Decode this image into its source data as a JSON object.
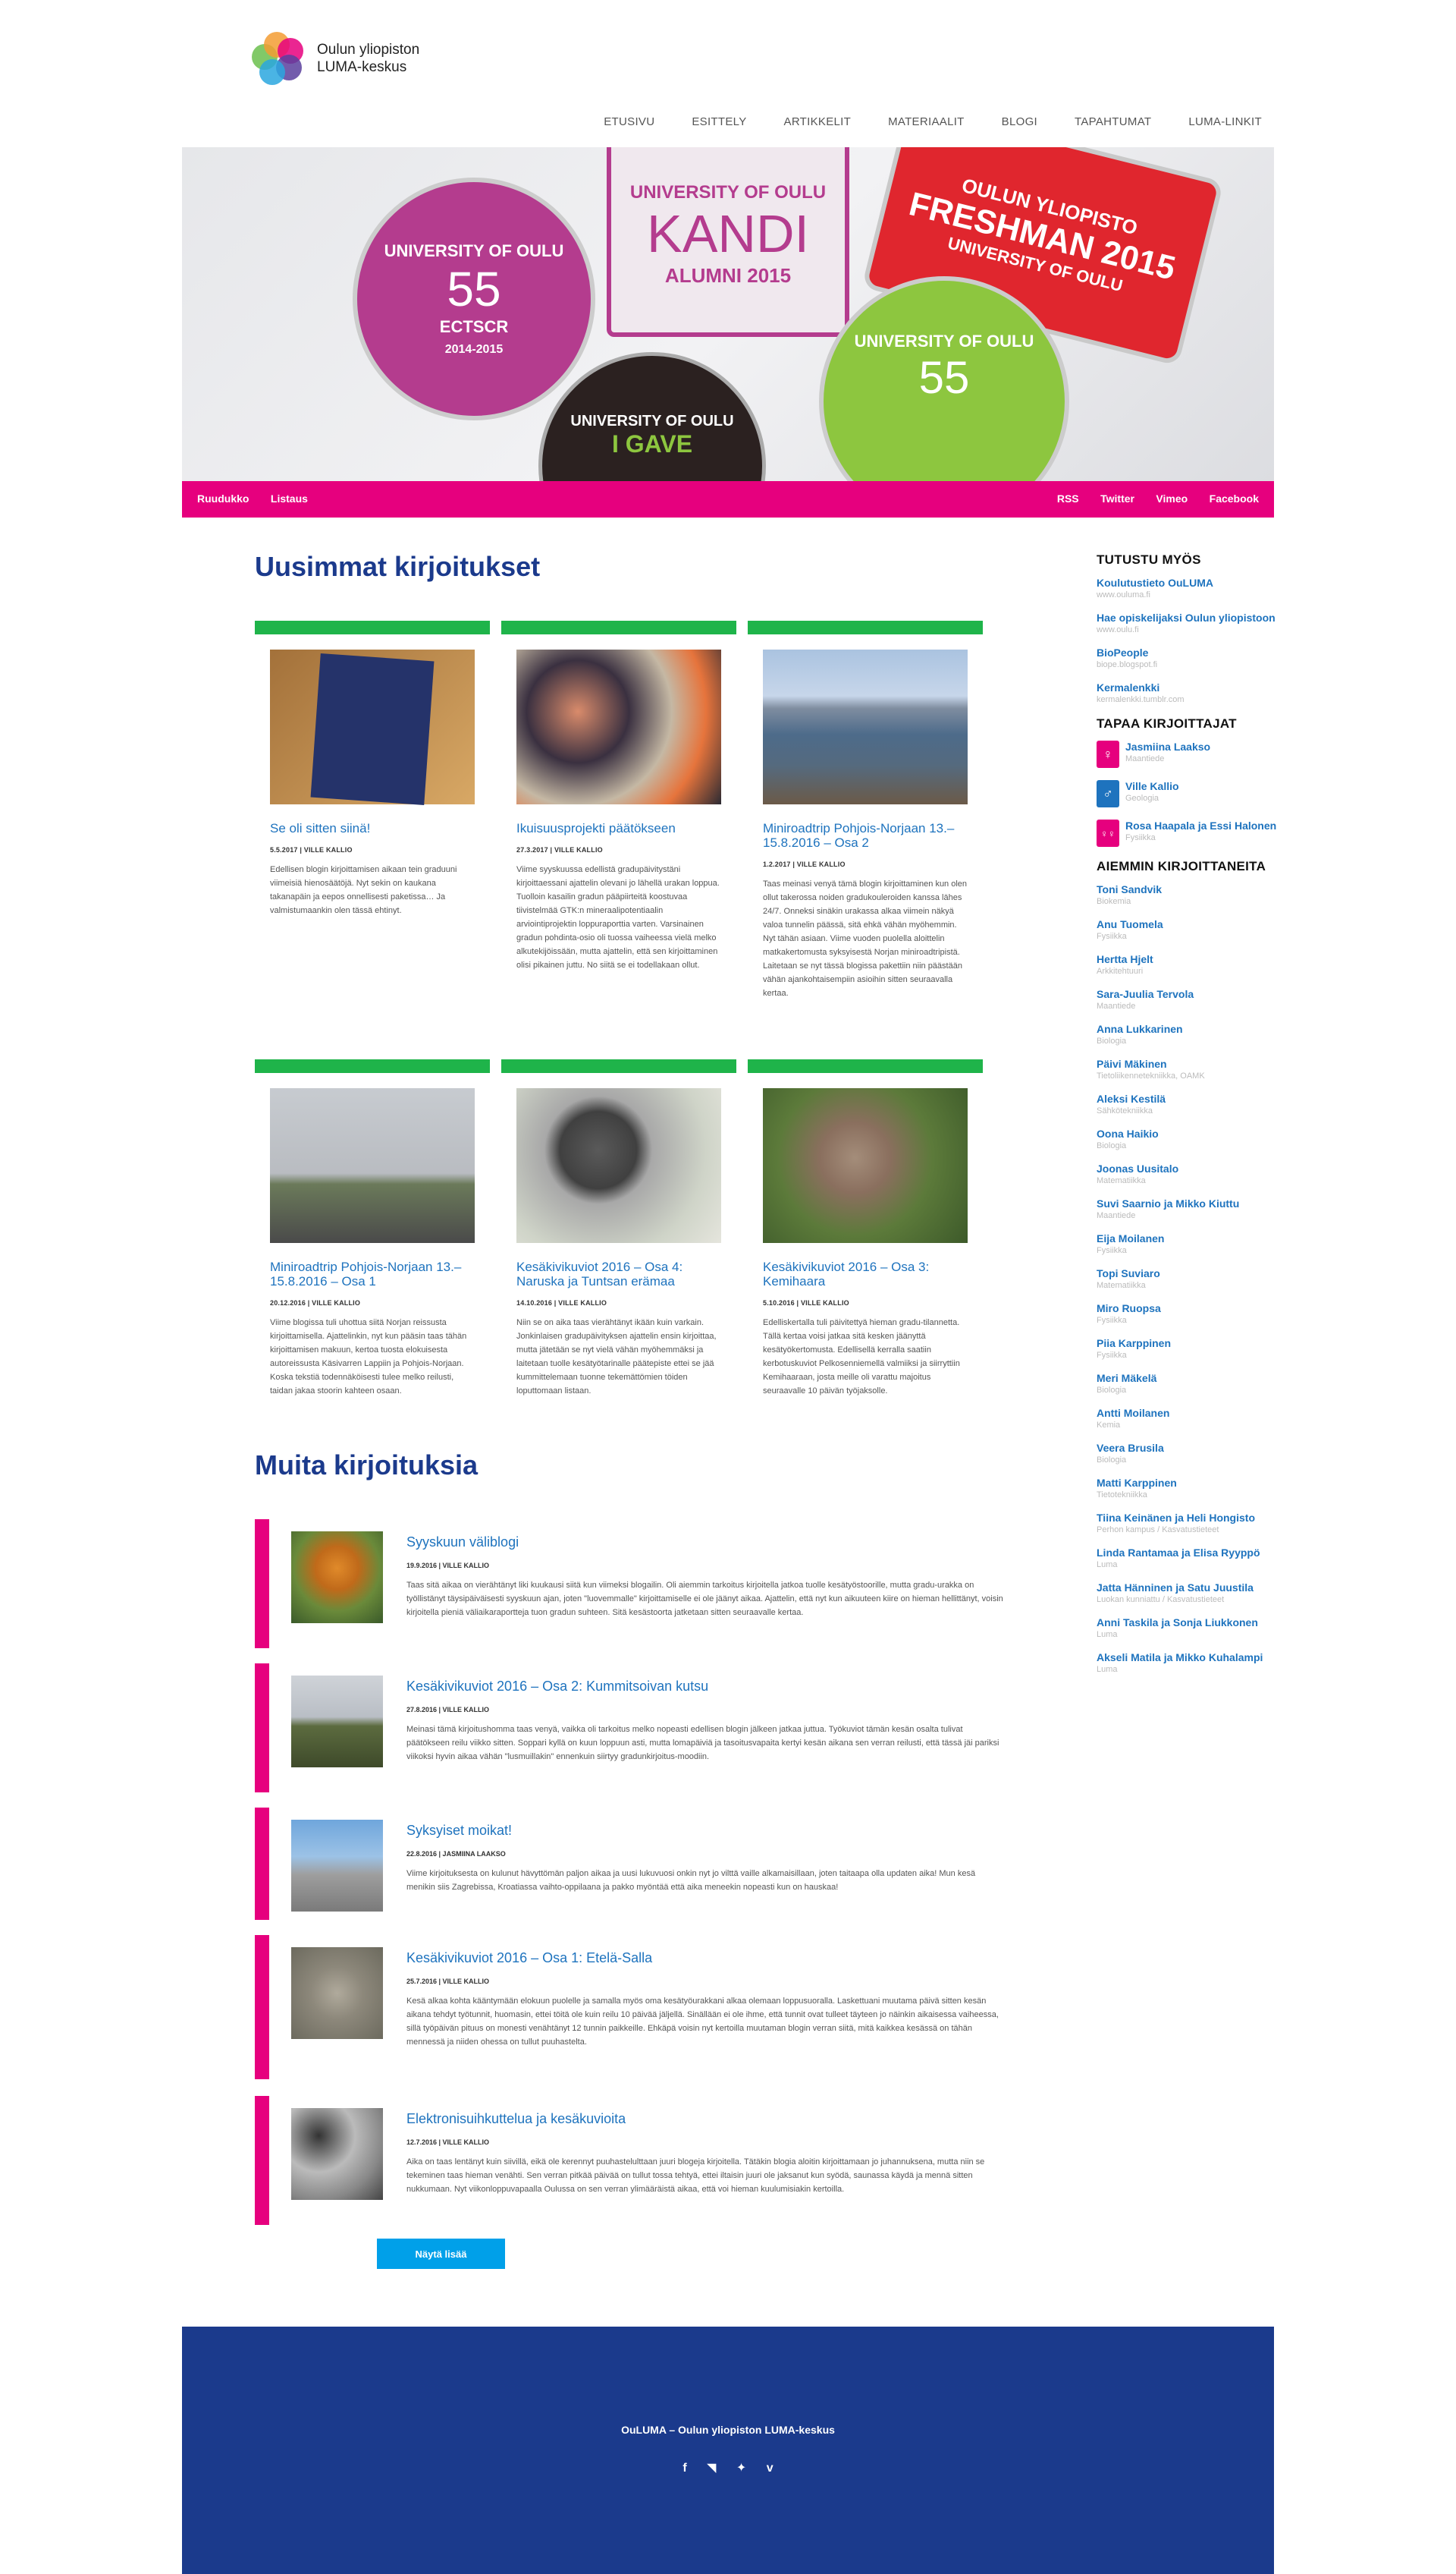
{
  "logo": {
    "line1": "Oulun yliopiston",
    "line2": "LUMA-keskus"
  },
  "nav": [
    "ETUSIVU",
    "ESITTELY",
    "ARTIKKELIT",
    "MATERIAALIT",
    "BLOGI",
    "TAPAHTUMAT",
    "LUMA-LINKIT"
  ],
  "hero": {
    "badge1": "UNIVERSITY OF OULU",
    "badge1_num": "55",
    "badge1_sub": "ECTSCR",
    "badge1_years": "2014-2015",
    "badge2_top": "UNIVERSITY OF OULU",
    "badge2_main": "KANDI",
    "badge2_sub": "ALUMNI 2015",
    "badge3_top": "OULUN YLIOPISTO",
    "badge3_main": "FRESHMAN 2015",
    "badge3_sub": "UNIVERSITY OF OULU",
    "badge4_top": "UNIVERSITY OF OULU",
    "badge4_main": "I GAVE",
    "badge5_top": "UNIVERSITY OF OULU",
    "badge5_num": "55"
  },
  "pinkbar": {
    "left": [
      "Ruudukko",
      "Listaus"
    ],
    "right": [
      "RSS",
      "Twitter",
      "Vimeo",
      "Facebook"
    ]
  },
  "latest_title": "Uusimmat kirjoitukset",
  "cards": [
    {
      "title": "Se oli sitten siinä!",
      "meta": "5.5.2017 | VILLE KALLIO",
      "text": "Edellisen blogin kirjoittamisen aikaan tein graduuni viimeisiä hienosäätöjä. Nyt sekin on kaukana takanapäin ja eepos onnellisesti paketissa… Ja valmistumaankin olen tässä ehtinyt."
    },
    {
      "title": "Ikuisuusprojekti päätökseen",
      "meta": "27.3.2017 | VILLE KALLIO",
      "text": "Viime syyskuussa edellistä gradupäivitystäni kirjoittaessani ajattelin olevani jo lähellä urakan loppua. Tuolloin kasailin gradun pääpiirteitä koostuvaa tiivistelmää GTK:n mineraalipotentiaalin arviointiprojektin loppuraporttia varten. Varsinainen gradun pohdinta-osio oli tuossa vaiheessa vielä melko alkutekijöissään, mutta ajattelin, että sen kirjoittaminen olisi pikainen juttu. No siitä se ei todellakaan ollut."
    },
    {
      "title": "Miniroadtrip Pohjois-Norjaan 13.–15.8.2016 – Osa 2",
      "meta": "1.2.2017 | VILLE KALLIO",
      "text": "Taas meinasi venyä tämä blogin kirjoittaminen kun olen ollut takerossa noiden gradukouleroiden kanssa lähes 24/7. Onneksi sinäkin urakassa alkaa viimein näkyä valoa tunnelin päässä, sitä ehkä vähän myöhemmin. Nyt tähän asiaan. Viime vuoden puolella aloittelin matkakertomusta syksyisestä Norjan miniroadtripistä. Laitetaan se nyt tässä blogissa pakettiin niin päästään vähän ajankohtaisempiin asioihin sitten seuraavalla kertaa."
    },
    {
      "title": "Miniroadtrip Pohjois-Norjaan 13.–15.8.2016 – Osa 1",
      "meta": "20.12.2016 | VILLE KALLIO",
      "text": "Viime blogissa tuli uhottua siitä Norjan reissusta kirjoittamisella. Ajattelinkin, nyt kun pääsin taas tähän kirjoittamisen makuun, kertoa tuosta elokuisesta autoreissusta Käsivarren Lappiin ja Pohjois-Norjaan. Koska tekstiä todennäköisesti tulee melko reilusti, taidan jakaa stoorin kahteen osaan."
    },
    {
      "title": "Kesäkivikuviot 2016 – Osa 4: Naruska ja Tuntsan erämaa",
      "meta": "14.10.2016 | VILLE KALLIO",
      "text": "Niin se on aika taas vierähtänyt ikään kuin varkain. Jonkinlaisen gradupäivityksen ajattelin ensin kirjoittaa, mutta jätetään se nyt vielä vähän myöhemmäksi ja laitetaan tuolle kesätyötarinalle päätepiste ettei se jää kummittelemaan tuonne tekemättömien töiden loputtomaan listaan."
    },
    {
      "title": "Kesäkivikuviot 2016 – Osa 3: Kemihaara",
      "meta": "5.10.2016 | VILLE KALLIO",
      "text": "Edelliskertalla tuli päivitettyä hieman gradu-tilannetta. Tällä kertaa voisi jatkaa sitä kesken jäänyttä kesätyökertomusta. Edellisellä kerralla saatiin kerbotuskuviot Pelkosenniemellä valmiiksi ja siirryttiin Kemihaaraan, josta meille oli varattu majoitus seuraavalle 10 päivän työjaksolle."
    }
  ],
  "other_title": "Muita kirjoituksia",
  "posts": [
    {
      "title": "Syyskuun väliblogi",
      "meta": "19.9.2016 | VILLE KALLIO",
      "text": "Taas sitä aikaa on vierähtänyt liki kuukausi siitä kun viimeksi blogailin. Oli aiemmin tarkoitus kirjoitella jatkoa tuolle kesätyöstoorille, mutta gradu-urakka on työllistänyt täysipäiväisesti syyskuun ajan, joten \"luovemmalle\" kirjoittamiselle ei ole jäänyt aikaa. Ajattelin, että nyt kun aikuuteen kiire on hieman hellittänyt, voisin kirjoitella pieniä väliaikaraportteja tuon gradun suhteen. Sitä kesästoorta jatketaan sitten seuraavalle kertaa."
    },
    {
      "title": "Kesäkivikuviot 2016 – Osa 2: Kummitsoivan kutsu",
      "meta": "27.8.2016 | VILLE KALLIO",
      "text": "Meinasi tämä kirjoitushomma taas venyä, vaikka oli tarkoitus melko nopeasti edellisen blogin jälkeen jatkaa juttua. Työkuviot tämän kesän osalta tulivat päätökseen reilu viikko sitten. Soppari kyllä on kuun loppuun asti, mutta lomapäiviä ja tasoitusvapaita kertyi kesän aikana sen verran reilusti, että tässä jäi pariksi viikoksi hyvin aikaa vähän \"lusmuillakin\" ennenkuin siirtyy gradunkirjoitus-moodiin."
    },
    {
      "title": "Syksyiset moikat!",
      "meta": "22.8.2016 | JASMIINA LAAKSO",
      "text": "Viime kirjoituksesta on kulunut hävyttömän paljon aikaa ja uusi lukuvuosi onkin nyt jo vilttä vaille alkamaisillaan, joten taitaapa olla updaten aika! Mun kesä menikin siis Zagrebissa, Kroatiassa vaihto-oppilaana ja pakko myöntää että aika meneekin nopeasti kun on hauskaa!"
    },
    {
      "title": "Kesäkivikuviot 2016 – Osa 1: Etelä-Salla",
      "meta": "25.7.2016 | VILLE KALLIO",
      "text": "Kesä alkaa kohta kääntymään elokuun puolelle ja samalla myös oma kesätyöurakkani alkaa olemaan loppusuoralla. Laskettuani muutama päivä sitten kesän aikana tehdyt työtunnit, huomasin, ettei töitä ole kuin reilu 10 päivää jäljellä. Sinällään ei ole ihme, että tunnit ovat tulleet täyteen jo näinkin aikaisessa vaiheessa, sillä työpäivän pituus on monesti venähtänyt 12 tunnin paikkeille. Ehkäpä voisin nyt kertoilla muutaman blogin verran siitä, mitä kaikkea kesässä on tähän mennessä ja niiden ohessa on tullut puuhastelta."
    },
    {
      "title": "Elektronisuihkuttelua ja kesäkuvioita",
      "meta": "12.7.2016 | VILLE KALLIO",
      "text": "Aika on taas lentänyt kuin siivillä, eikä ole kerennyt puuhastelulttaan juuri blogeja kirjoitella. Tätäkin blogia aloitin kirjoittamaan jo juhannuksena, mutta niin se tekeminen taas hieman venähti. Sen verran pitkää päivää on tullut tossa tehtyä, ettei iltaisin juuri ole jaksanut kun syödä, saunassa käydä ja mennä sitten nukkumaan. Nyt viikonloppuvapaalla Oulussa on sen verran ylimääräistä aikaa, että voi hieman kuulumisiakin kertoilla."
    }
  ],
  "more_button": "Näytä lisää",
  "sidebar": {
    "explore_title": "TUTUSTU MYÖS",
    "explore": [
      {
        "name": "Koulutustieto OuLUMA",
        "url": "www.ouluma.fi"
      },
      {
        "name": "Hae opiskelijaksi Oulun yliopistoon",
        "url": "www.oulu.fi"
      },
      {
        "name": "BioPeople",
        "url": "biope.blogspot.fi"
      },
      {
        "name": "Kermalenkki",
        "url": "kermalenkki.tumblr.com"
      }
    ],
    "writers_title": "TAPAA KIRJOITTAJAT",
    "writers": [
      {
        "name": "Jasmiina Laakso",
        "field": "Maantiede",
        "color": "#e6007e",
        "icon": "female-icon"
      },
      {
        "name": "Ville Kallio",
        "field": "Geologia",
        "color": "#1e73be",
        "icon": "male-icon"
      },
      {
        "name": "Rosa Haapala ja Essi Halonen",
        "field": "Fysiikka",
        "color": "#e6007e",
        "icon": "pair-icon"
      }
    ],
    "past_title": "AIEMMIN KIRJOITTANEITA",
    "past": [
      {
        "name": "Toni Sandvik",
        "field": "Biokemia"
      },
      {
        "name": "Anu Tuomela",
        "field": "Fysiikka"
      },
      {
        "name": "Hertta Hjelt",
        "field": "Arkkitehtuuri"
      },
      {
        "name": "Sara-Juulia Tervola",
        "field": "Maantiede"
      },
      {
        "name": "Anna Lukkarinen",
        "field": "Biologia"
      },
      {
        "name": "Päivi Mäkinen",
        "field": "Tietoliikennetekniikka, OAMK"
      },
      {
        "name": "Aleksi Kestilä",
        "field": "Sähkötekniikka"
      },
      {
        "name": "Oona Haikio",
        "field": "Biologia"
      },
      {
        "name": "Joonas Uusitalo",
        "field": "Matematiikka"
      },
      {
        "name": "Suvi Saarnio ja Mikko Kiuttu",
        "field": "Maantiede"
      },
      {
        "name": "Eija Moilanen",
        "field": "Fysiikka"
      },
      {
        "name": "Topi Suviaro",
        "field": "Matematiikka"
      },
      {
        "name": "Miro Ruopsa",
        "field": "Fysiikka"
      },
      {
        "name": "Piia Karppinen",
        "field": "Fysiikka"
      },
      {
        "name": "Meri Mäkelä",
        "field": "Biologia"
      },
      {
        "name": "Antti Moilanen",
        "field": "Kemia"
      },
      {
        "name": "Veera Brusila",
        "field": "Biologia"
      },
      {
        "name": "Matti Karppinen",
        "field": "Tietotekniikka"
      },
      {
        "name": "Tiina Keinänen ja Heli Hongisto",
        "field": "Perhon kampus / Kasvatustieteet"
      },
      {
        "name": "Linda Rantamaa ja Elisa Ryyppö",
        "field": "Luma"
      },
      {
        "name": "Jatta Hänninen ja Satu Juustila",
        "field": "Luokan kunniattu / Kasvatustieteet"
      },
      {
        "name": "Anni Taskila ja Sonja Liukkonen",
        "field": "Luma"
      },
      {
        "name": "Akseli Matila ja Mikko Kuhalampi",
        "field": "Luma"
      }
    ]
  },
  "footer": {
    "title": "OuLUMA – Oulun yliopiston LUMA-keskus",
    "icons": [
      "facebook-icon",
      "rss-icon",
      "twitter-icon",
      "vimeo-icon"
    ]
  }
}
